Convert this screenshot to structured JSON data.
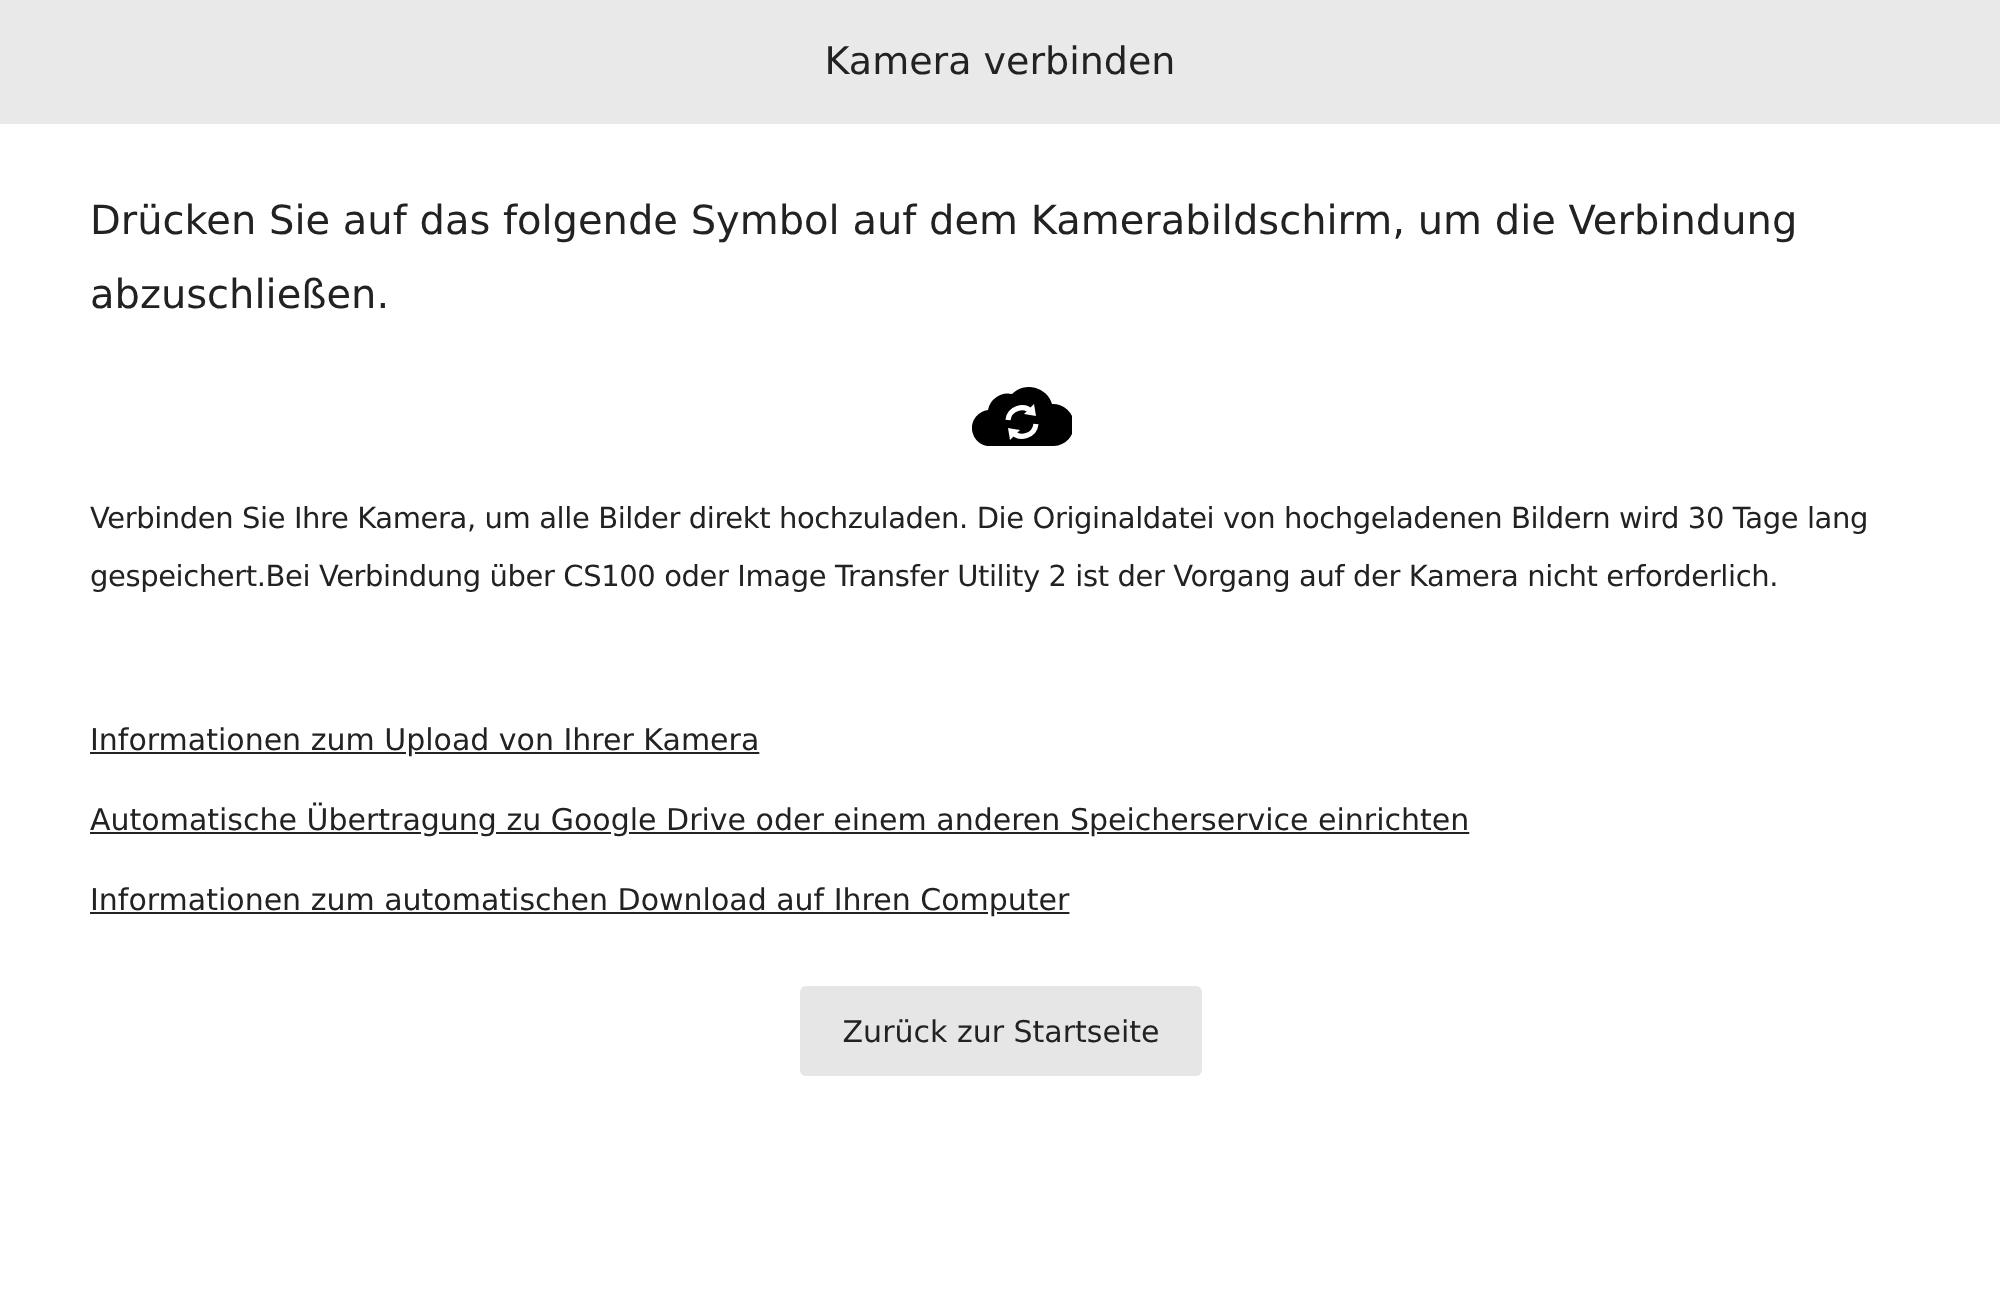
{
  "dialog": {
    "title": "Kamera verbinden",
    "instruction": "Drücken Sie auf das folgende Symbol auf dem Kamerabildschirm, um die Verbindung abzuschließen.",
    "description": "Verbinden Sie Ihre Kamera, um alle Bilder direkt hochzuladen. Die Originaldatei von hochgeladenen Bildern wird 30 Tage lang gespeichert.Bei Verbindung über CS100 oder Image Transfer Utility 2 ist der Vorgang auf der Kamera nicht erforderlich.",
    "links": [
      "Informationen zum Upload von Ihrer Kamera",
      "Automatische Übertragung zu Google Drive oder einem anderen Speicherservice einrichten",
      "Informationen zum automatischen Download auf Ihren Computer"
    ],
    "button": "Zurück zur Startseite"
  }
}
